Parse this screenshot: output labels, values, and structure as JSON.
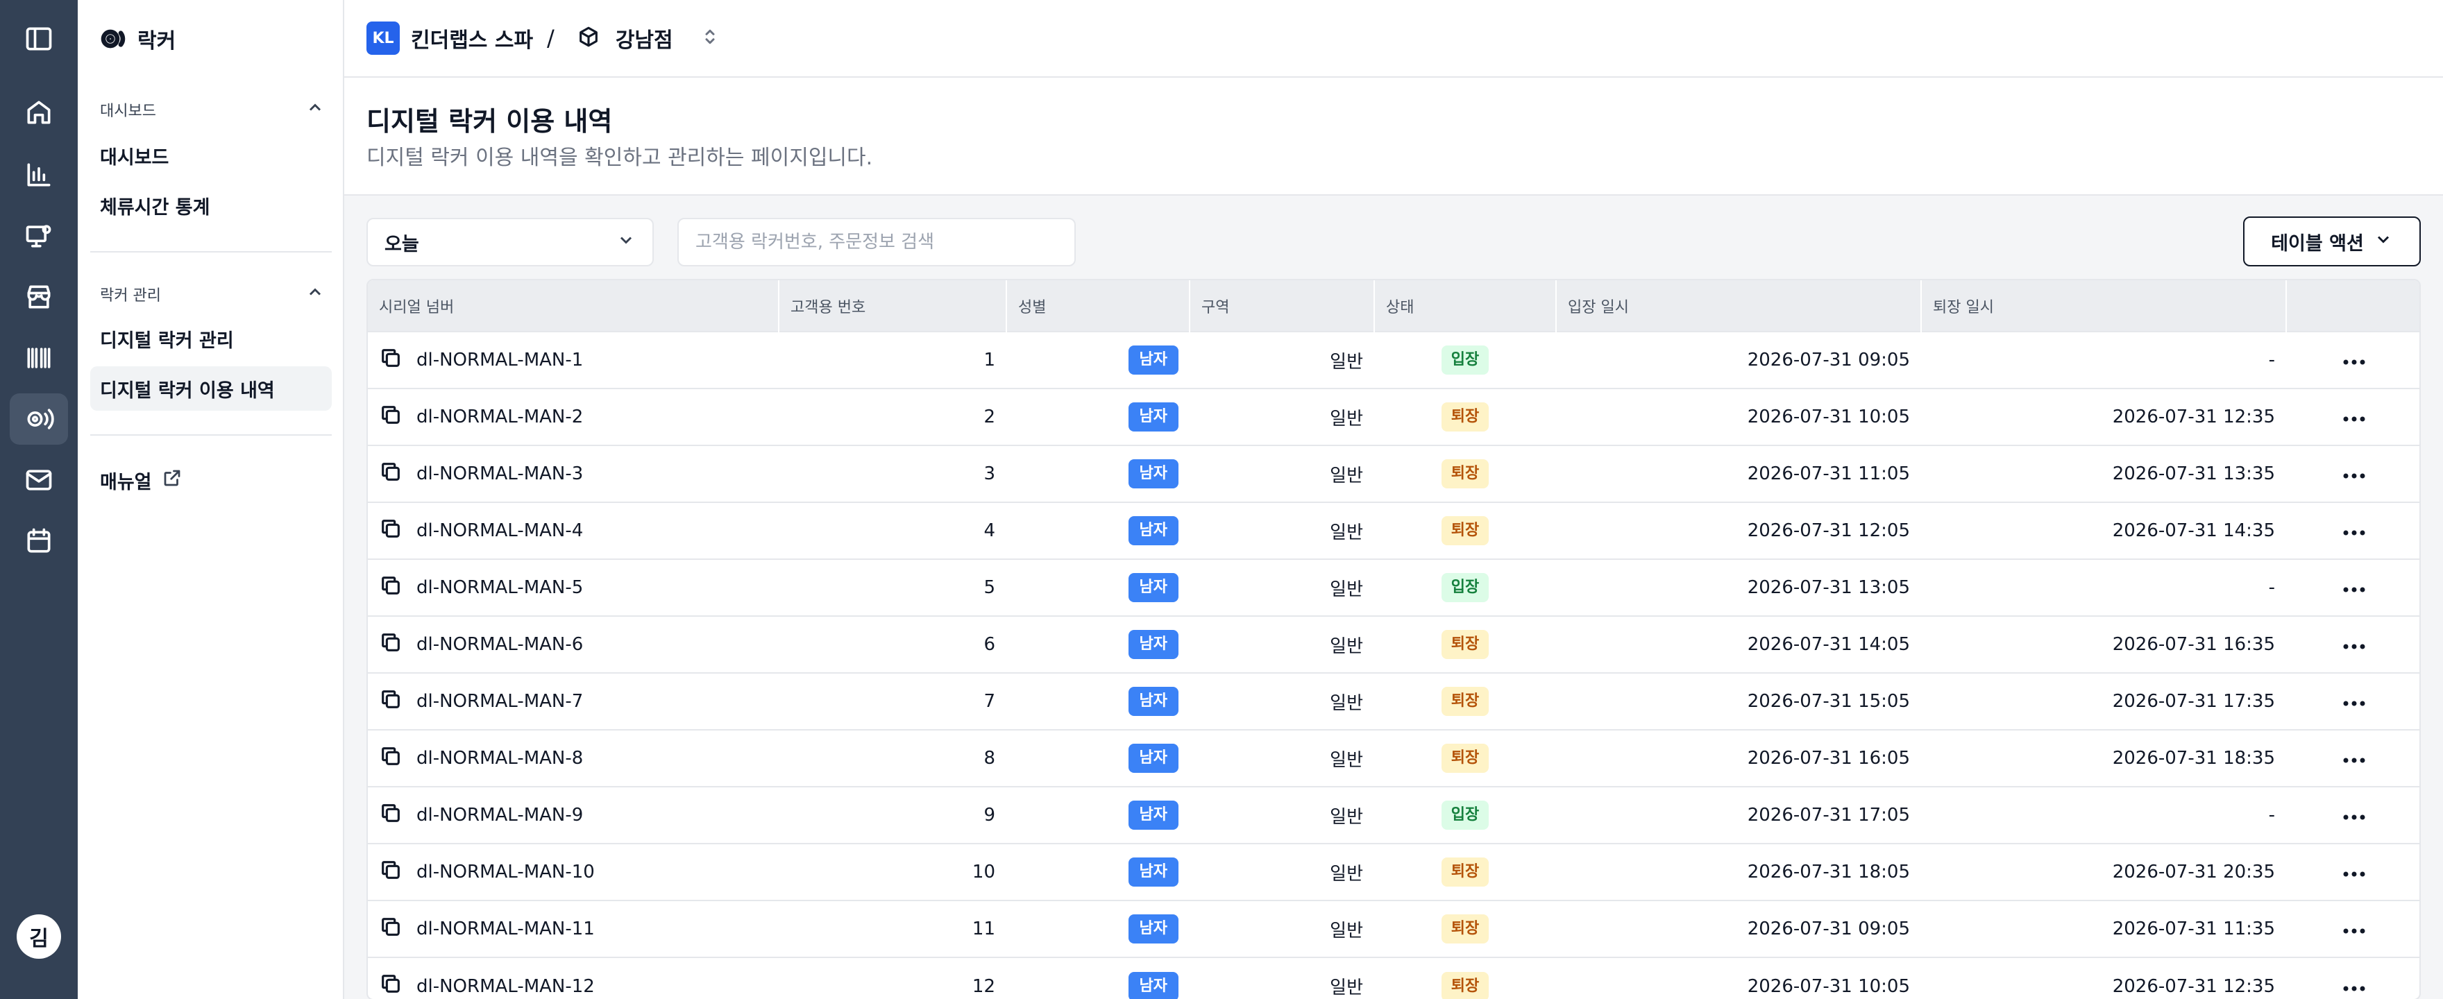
{
  "sidebar": {
    "brand": "락커",
    "sections": [
      {
        "title": "대시보드",
        "items": [
          "대시보드",
          "체류시간 통계"
        ]
      },
      {
        "title": "락커 관리",
        "items": [
          "디지털 락커 관리",
          "디지털 락커 이용 내역"
        ]
      }
    ],
    "active_item": "디지털 락커 이용 내역",
    "manual": "매뉴얼"
  },
  "rail": {
    "icons": [
      "sidebar-toggle-icon",
      "home-icon",
      "chart-icon",
      "monitor-settings-icon",
      "store-icon",
      "barcode-icon",
      "locker-icon",
      "mail-icon",
      "calendar-icon"
    ],
    "active": "locker-icon",
    "avatar": "김"
  },
  "topbar": {
    "org_badge": "KL",
    "org_name": "킨더랩스 스파",
    "separator": "/",
    "store_name": "강남점"
  },
  "header": {
    "title": "디지털 락커 이용 내역",
    "subtitle": "디지털 락커 이용 내역을 확인하고 관리하는 페이지입니다."
  },
  "toolbar": {
    "period_value": "오늘",
    "search_placeholder": "고객용 락커번호, 주문정보 검색",
    "table_action_label": "테이블 액션"
  },
  "table": {
    "columns": [
      "시리얼 넘버",
      "고객용 번호",
      "성별",
      "구역",
      "상태",
      "입장 일시",
      "퇴장 일시",
      ""
    ],
    "rows": [
      {
        "serial": "dl-NORMAL-MAN-1",
        "number": "1",
        "gender": "남자",
        "zone": "일반",
        "status": "입장",
        "entry": "2026-07-31 09:05",
        "exit": "-"
      },
      {
        "serial": "dl-NORMAL-MAN-2",
        "number": "2",
        "gender": "남자",
        "zone": "일반",
        "status": "퇴장",
        "entry": "2026-07-31 10:05",
        "exit": "2026-07-31 12:35"
      },
      {
        "serial": "dl-NORMAL-MAN-3",
        "number": "3",
        "gender": "남자",
        "zone": "일반",
        "status": "퇴장",
        "entry": "2026-07-31 11:05",
        "exit": "2026-07-31 13:35"
      },
      {
        "serial": "dl-NORMAL-MAN-4",
        "number": "4",
        "gender": "남자",
        "zone": "일반",
        "status": "퇴장",
        "entry": "2026-07-31 12:05",
        "exit": "2026-07-31 14:35"
      },
      {
        "serial": "dl-NORMAL-MAN-5",
        "number": "5",
        "gender": "남자",
        "zone": "일반",
        "status": "입장",
        "entry": "2026-07-31 13:05",
        "exit": "-"
      },
      {
        "serial": "dl-NORMAL-MAN-6",
        "number": "6",
        "gender": "남자",
        "zone": "일반",
        "status": "퇴장",
        "entry": "2026-07-31 14:05",
        "exit": "2026-07-31 16:35"
      },
      {
        "serial": "dl-NORMAL-MAN-7",
        "number": "7",
        "gender": "남자",
        "zone": "일반",
        "status": "퇴장",
        "entry": "2026-07-31 15:05",
        "exit": "2026-07-31 17:35"
      },
      {
        "serial": "dl-NORMAL-MAN-8",
        "number": "8",
        "gender": "남자",
        "zone": "일반",
        "status": "퇴장",
        "entry": "2026-07-31 16:05",
        "exit": "2026-07-31 18:35"
      },
      {
        "serial": "dl-NORMAL-MAN-9",
        "number": "9",
        "gender": "남자",
        "zone": "일반",
        "status": "입장",
        "entry": "2026-07-31 17:05",
        "exit": "-"
      },
      {
        "serial": "dl-NORMAL-MAN-10",
        "number": "10",
        "gender": "남자",
        "zone": "일반",
        "status": "퇴장",
        "entry": "2026-07-31 18:05",
        "exit": "2026-07-31 20:35"
      },
      {
        "serial": "dl-NORMAL-MAN-11",
        "number": "11",
        "gender": "남자",
        "zone": "일반",
        "status": "퇴장",
        "entry": "2026-07-31 09:05",
        "exit": "2026-07-31 11:35"
      },
      {
        "serial": "dl-NORMAL-MAN-12",
        "number": "12",
        "gender": "남자",
        "zone": "일반",
        "status": "퇴장",
        "entry": "2026-07-31 10:05",
        "exit": "2026-07-31 12:35"
      }
    ]
  },
  "colors": {
    "rail_bg": "#334155",
    "accent_blue": "#3b82f6",
    "status_in_bg": "#dcfce7",
    "status_out_bg": "#fef3c7"
  }
}
